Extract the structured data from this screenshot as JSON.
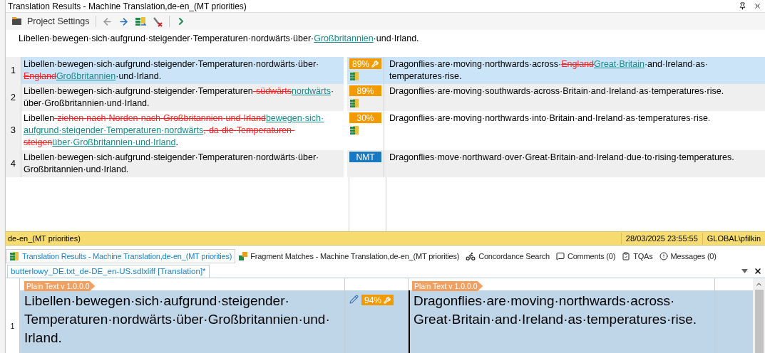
{
  "window": {
    "title": "Translation Results - Machine Translation,de-en_(MT priorities)"
  },
  "toolbar": {
    "project_settings": "Project Settings",
    "next_disabled": false
  },
  "source_line": [
    {
      "kind": "plain",
      "text": "Libellen·bewegen·sich·aufgrund·steigender·Temperaturen·nordwärts·über·"
    },
    {
      "kind": "link",
      "text": "Großbritannien"
    },
    {
      "kind": "plain",
      "text": "·und·Irland."
    }
  ],
  "results": [
    {
      "number": "1",
      "selected": true,
      "source": [
        {
          "kind": "plain",
          "text": "Libellen·bewegen·sich·aufgrund·steigender·Temperaturen·nordwärts·über·"
        },
        {
          "kind": "deleted",
          "text": "England"
        },
        {
          "kind": "inserted",
          "text": "Großbritannien"
        },
        {
          "kind": "plain",
          "text": "·und·Irland."
        }
      ],
      "badge": {
        "kind": "fuzzy",
        "text": "89%",
        "edited": true,
        "tm_icon": true
      },
      "target": [
        {
          "kind": "plain",
          "text": "Dragonflies·are·moving·northwards·across·"
        },
        {
          "kind": "deleted",
          "text": "England"
        },
        {
          "kind": "inserted",
          "text": "Great·Britain"
        },
        {
          "kind": "plain",
          "text": "·and·Ireland·as·temperatures·rise."
        }
      ]
    },
    {
      "number": "2",
      "selected": false,
      "source": [
        {
          "kind": "plain",
          "text": "Libellen·bewegen·sich·aufgrund·steigender·Temperaturen"
        },
        {
          "kind": "deleted",
          "text": "·südwärts"
        },
        {
          "kind": "inserted",
          "text": "nordwärts"
        },
        {
          "kind": "plain",
          "text": "·über·Großbritannien·und·Irland."
        }
      ],
      "badge": {
        "kind": "fuzzy",
        "text": "89%",
        "edited": false,
        "tm_icon": true
      },
      "target": [
        {
          "kind": "plain",
          "text": "Dragonflies·are·moving·southwards·across·Britain·and·Ireland·as·temperatures·rise."
        }
      ]
    },
    {
      "number": "3",
      "selected": false,
      "source": [
        {
          "kind": "plain",
          "text": "Libellen"
        },
        {
          "kind": "deleted",
          "text": "·ziehen·nach·Norden·nach·Großbritannien·und·Irland"
        },
        {
          "kind": "inserted",
          "text": "bewegen·sich·aufgrund·steigender·Temperaturen·nordwärts"
        },
        {
          "kind": "deleted",
          "text": ",·da·die·Temperaturen·steigen"
        },
        {
          "kind": "inserted",
          "text": "über·Großbritannien·und·Irland"
        },
        {
          "kind": "plain",
          "text": "."
        }
      ],
      "badge": {
        "kind": "fuzzy",
        "text": "30%",
        "edited": false,
        "tm_icon": true
      },
      "target": [
        {
          "kind": "plain",
          "text": "Dragonflies·are·moving·northwards·into·Britain·and·Ireland·as·temperatures·rise."
        }
      ]
    },
    {
      "number": "4",
      "selected": false,
      "source": [
        {
          "kind": "plain",
          "text": "Libellen·bewegen·sich·aufgrund·steigender·Temperaturen·nordwärts·über·Großbritannien·und·Irland."
        }
      ],
      "badge": {
        "kind": "nmt",
        "text": "NMT",
        "edited": false,
        "tm_icon": false
      },
      "target": [
        {
          "kind": "plain",
          "text": "Dragonflies·move·northward·over·Great·Britain·and·Ireland·due·to·rising·temperatures."
        }
      ]
    }
  ],
  "status_bar": {
    "provider": "de-en_(MT priorities)",
    "timestamp": "28/03/2025 23:55:55",
    "user": "GLOBAL\\pfilkin"
  },
  "panel_tabs": [
    {
      "kind": "results",
      "label": "Translation Results - Machine Translation,de-en_(MT priorities)",
      "selected": true
    },
    {
      "kind": "fragments",
      "label": "Fragment Matches - Machine Translation,de-en_(MT priorities)",
      "selected": false
    },
    {
      "kind": "concordance",
      "label": "Concordance Search",
      "selected": false
    },
    {
      "kind": "comments",
      "label": "Comments (0)",
      "selected": false
    },
    {
      "kind": "tqa",
      "label": "TQAs",
      "selected": false
    },
    {
      "kind": "messages",
      "label": "Messages (0)",
      "selected": false
    }
  ],
  "document_tab": {
    "label": "butterlowy_DE.txt_de-DE_en-US.sdlxliff [Translation]*",
    "selected": true
  },
  "editor": {
    "number": "1",
    "source_tag": "Plain Text v 1.0.0.0",
    "source": "Libellen·bewegen·sich·aufgrund·steigender·Temperaturen·nordwärts·über·Großbritannien·und·Irland.",
    "badge": {
      "kind": "fuzzy",
      "text": "94%",
      "edited": true
    },
    "target_tag": "Plain Text v 1.0.0.0",
    "target": "Dragonflies·are·moving·northwards·across·Great·Britain·and·Ireland·as·temperatures·rise."
  }
}
